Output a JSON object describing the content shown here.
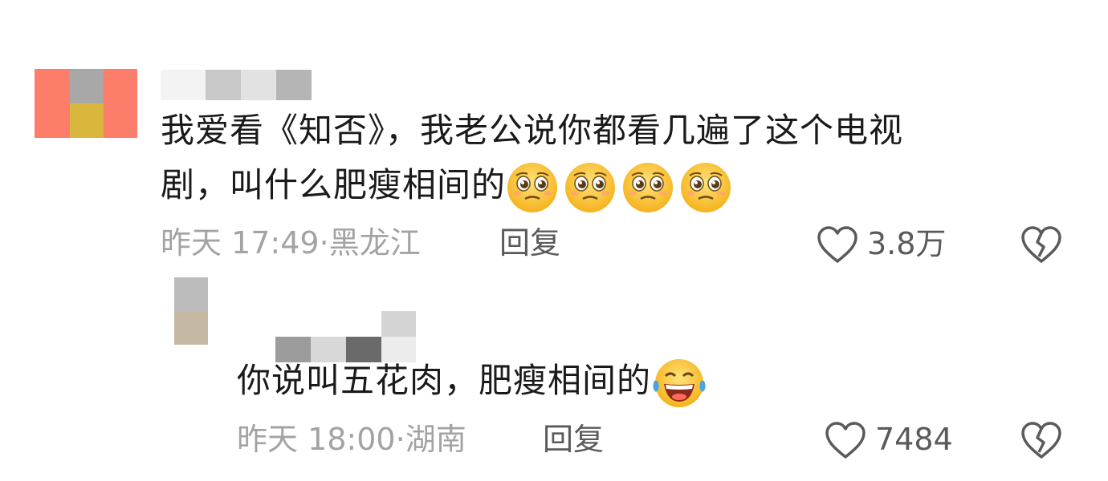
{
  "comments": [
    {
      "text_line1": "我爱看《知否》，我老公说你都看几遍了这个电视",
      "text_line2": "剧，叫什么肥瘦相间的",
      "emoji": "pleading-face-emoji",
      "time": "昨天 17:49",
      "separator": "·",
      "location": "黑龙江",
      "reply_label": "回复",
      "likes": "3.8万"
    },
    {
      "text": "你说叫五花肉，肥瘦相间的",
      "emoji": "laughing-tears-emoji",
      "time": "昨天 18:00",
      "separator": "·",
      "location": "湖南",
      "reply_label": "回复",
      "likes": "7484"
    }
  ],
  "icons": {
    "like": "heart-outline-icon",
    "dislike": "broken-heart-icon"
  },
  "colors": {
    "text": "#1a1a1a",
    "meta": "#a3a3a3",
    "action": "#5a5a5a",
    "avatar1": [
      "#fb7d6a",
      "#a8a8a8",
      "#d8b73c"
    ],
    "avatar2": [
      "#bcbcbc",
      "#c6b9a4"
    ]
  }
}
